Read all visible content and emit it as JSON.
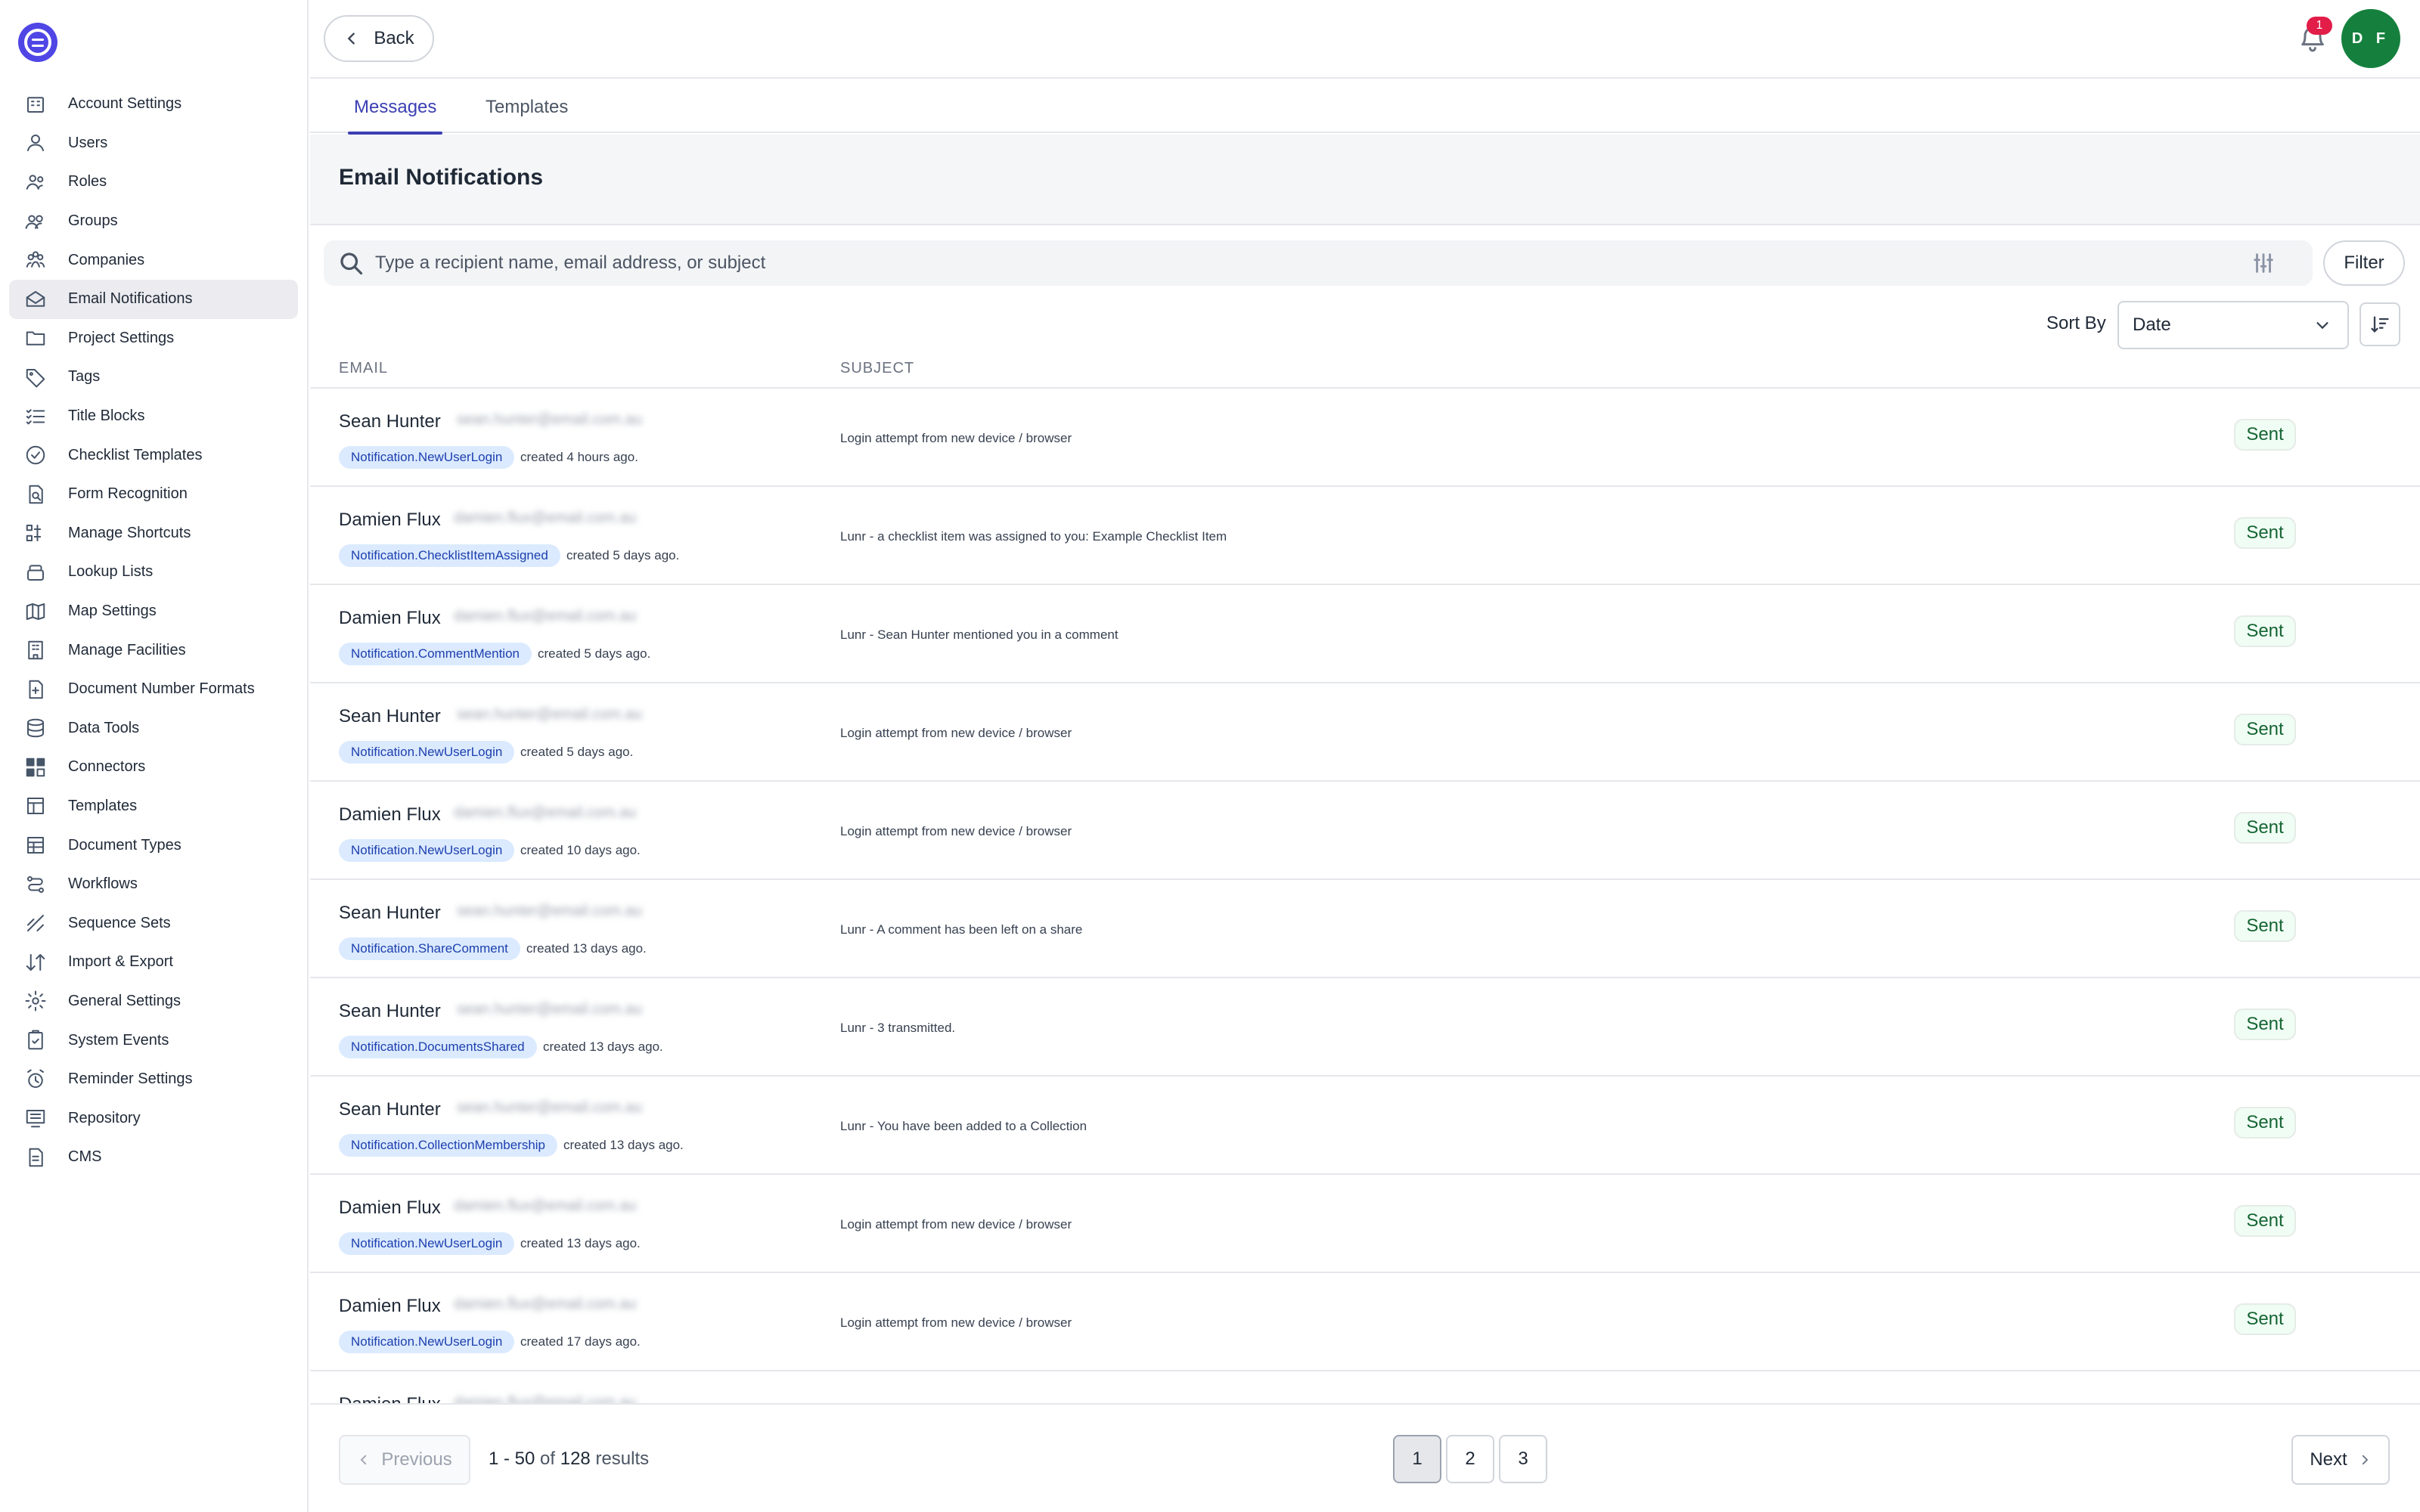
{
  "header": {
    "back_label": "Back",
    "notification_count": "1",
    "avatar_initials": "D F"
  },
  "tabs": [
    {
      "label": "Messages",
      "active": true
    },
    {
      "label": "Templates",
      "active": false
    }
  ],
  "page_title": "Email Notifications",
  "search": {
    "placeholder": "Type a recipient name, email address, or subject",
    "value": ""
  },
  "filter_label": "Filter",
  "sort": {
    "label": "Sort By",
    "value": "Date"
  },
  "columns": {
    "email": "EMAIL",
    "subject": "SUBJECT"
  },
  "sidebar": {
    "items": [
      {
        "label": "Account Settings",
        "icon": "building-icon"
      },
      {
        "label": "Users",
        "icon": "user-icon"
      },
      {
        "label": "Roles",
        "icon": "roles-icon"
      },
      {
        "label": "Groups",
        "icon": "group-icon"
      },
      {
        "label": "Companies",
        "icon": "companies-icon"
      },
      {
        "label": "Email Notifications",
        "icon": "envelope-icon",
        "active": true
      },
      {
        "label": "Project Settings",
        "icon": "folder-icon"
      },
      {
        "label": "Tags",
        "icon": "tag-icon"
      },
      {
        "label": "Title Blocks",
        "icon": "list-check-icon"
      },
      {
        "label": "Checklist Templates",
        "icon": "check-circle-icon"
      },
      {
        "label": "Form Recognition",
        "icon": "doc-search-icon"
      },
      {
        "label": "Manage Shortcuts",
        "icon": "shortcut-icon"
      },
      {
        "label": "Lookup Lists",
        "icon": "stack-icon"
      },
      {
        "label": "Map Settings",
        "icon": "map-icon"
      },
      {
        "label": "Manage Facilities",
        "icon": "facility-icon"
      },
      {
        "label": "Document Number Formats",
        "icon": "doc-plus-icon"
      },
      {
        "label": "Data Tools",
        "icon": "database-icon"
      },
      {
        "label": "Connectors",
        "icon": "connectors-icon"
      },
      {
        "label": "Templates",
        "icon": "template-icon"
      },
      {
        "label": "Document Types",
        "icon": "doc-types-icon"
      },
      {
        "label": "Workflows",
        "icon": "workflow-icon"
      },
      {
        "label": "Sequence Sets",
        "icon": "sequence-icon"
      },
      {
        "label": "Import & Export",
        "icon": "import-export-icon"
      },
      {
        "label": "General Settings",
        "icon": "gear-icon"
      },
      {
        "label": "System Events",
        "icon": "clipboard-icon"
      },
      {
        "label": "Reminder Settings",
        "icon": "alarm-icon"
      },
      {
        "label": "Repository",
        "icon": "repository-icon"
      },
      {
        "label": "CMS",
        "icon": "file-icon"
      }
    ]
  },
  "rows": [
    {
      "name": "Sean Hunter",
      "email": "sean.hunter@email.com.au",
      "type": "Notification.NewUserLogin",
      "created": "created 4 hours ago.",
      "subject": "Login attempt from new device / browser",
      "status": "Sent"
    },
    {
      "name": "Damien Flux",
      "email": "damien.flux@email.com.au",
      "type": "Notification.ChecklistItemAssigned",
      "created": "created 5 days ago.",
      "subject": "Lunr - a checklist item was assigned to you: Example Checklist Item",
      "status": "Sent"
    },
    {
      "name": "Damien Flux",
      "email": "damien.flux@email.com.au",
      "type": "Notification.CommentMention",
      "created": "created 5 days ago.",
      "subject": "Lunr - Sean Hunter mentioned you in a comment",
      "status": "Sent"
    },
    {
      "name": "Sean Hunter",
      "email": "sean.hunter@email.com.au",
      "type": "Notification.NewUserLogin",
      "created": "created 5 days ago.",
      "subject": "Login attempt from new device / browser",
      "status": "Sent"
    },
    {
      "name": "Damien Flux",
      "email": "damien.flux@email.com.au",
      "type": "Notification.NewUserLogin",
      "created": "created 10 days ago.",
      "subject": "Login attempt from new device / browser",
      "status": "Sent"
    },
    {
      "name": "Sean Hunter",
      "email": "sean.hunter@email.com.au",
      "type": "Notification.ShareComment",
      "created": "created 13 days ago.",
      "subject": "Lunr - A comment has been left on a share",
      "status": "Sent"
    },
    {
      "name": "Sean Hunter",
      "email": "sean.hunter@email.com.au",
      "type": "Notification.DocumentsShared",
      "created": "created 13 days ago.",
      "subject": "Lunr - 3 transmitted.",
      "status": "Sent"
    },
    {
      "name": "Sean Hunter",
      "email": "sean.hunter@email.com.au",
      "type": "Notification.CollectionMembership",
      "created": "created 13 days ago.",
      "subject": "Lunr - You have been added to a Collection",
      "status": "Sent"
    },
    {
      "name": "Damien Flux",
      "email": "damien.flux@email.com.au",
      "type": "Notification.NewUserLogin",
      "created": "created 13 days ago.",
      "subject": "Login attempt from new device / browser",
      "status": "Sent"
    },
    {
      "name": "Damien Flux",
      "email": "damien.flux@email.com.au",
      "type": "Notification.NewUserLogin",
      "created": "created 17 days ago.",
      "subject": "Login attempt from new device / browser",
      "status": "Sent"
    },
    {
      "name": "Damien Flux",
      "email": "damien.flux@email.com.au",
      "type": "",
      "created": "",
      "subject": "",
      "status": ""
    }
  ],
  "pagination": {
    "previous_label": "Previous",
    "next_label": "Next",
    "range": "1 - 50",
    "of_label": "of",
    "total": "128",
    "results_label": "results",
    "pages": [
      "1",
      "2",
      "3"
    ],
    "current_page": "1"
  },
  "colors": {
    "accent": "#3b3fb3",
    "logo": "#4f46e5",
    "avatar": "#15803d",
    "badge_bg": "#dbeafe",
    "badge_text": "#1e40af",
    "status_text": "#166534",
    "notification_badge": "#e11d48"
  }
}
